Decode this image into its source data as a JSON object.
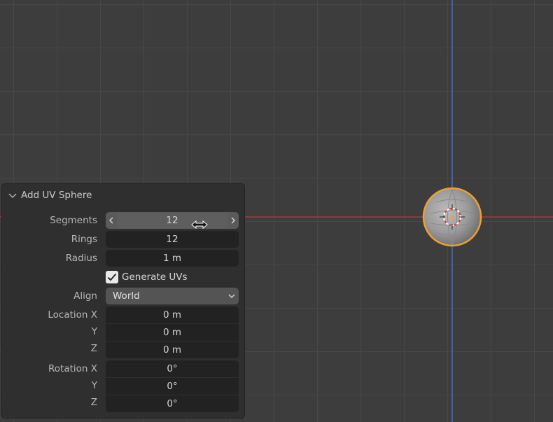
{
  "panel": {
    "title": "Add UV Sphere",
    "segments": {
      "label": "Segments",
      "value": "12"
    },
    "rings": {
      "label": "Rings",
      "value": "12"
    },
    "radius": {
      "label": "Radius",
      "value": "1 m"
    },
    "generate_uvs": {
      "label": "Generate UVs",
      "checked": true
    },
    "align": {
      "label": "Align",
      "value": "World"
    },
    "location": {
      "label_x": "Location X",
      "label_y": "Y",
      "label_z": "Z",
      "x": "0 m",
      "y": "0 m",
      "z": "0 m"
    },
    "rotation": {
      "label_x": "Rotation X",
      "label_y": "Y",
      "label_z": "Z",
      "x": "0°",
      "y": "0°",
      "z": "0°"
    }
  },
  "colors": {
    "selection_outline": "#f0a030",
    "axis_x": "#8c3a3a",
    "axis_y": "#4e5e94"
  },
  "icons": [
    "chevron-down-icon",
    "chevron-left-icon",
    "chevron-right-icon",
    "checkmark-icon",
    "dropdown-arrow-icon",
    "resize-horizontal-cursor-icon",
    "3d-cursor-icon"
  ]
}
